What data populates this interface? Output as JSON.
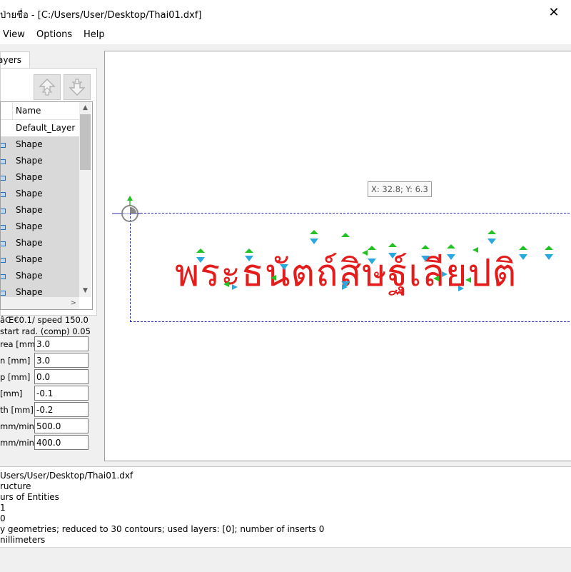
{
  "window": {
    "title": "ป่ายชื่อ - [C:/Users/User/Desktop/Thai01.dxf]",
    "close_glyph": "✕"
  },
  "menu": [
    "View",
    "Options",
    "Help"
  ],
  "layers_panel": {
    "tab_label": "ayers",
    "column_header": "Name",
    "rows": [
      "Default_Layer",
      "Shape",
      "Shape",
      "Shape",
      "Shape",
      "Shape",
      "Shape",
      "Shape",
      "Shape",
      "Shape",
      "Shape"
    ],
    "move_up_icon": "move-up-arrow-icon",
    "move_down_icon": "move-down-arrow-icon"
  },
  "params": {
    "speed_line": "âŒ€0.1/ speed 150.0",
    "start_rad_line": "start rad. (comp) 0.05",
    "fields": [
      {
        "label": "rea [mm]",
        "value": "3.0"
      },
      {
        "label": "n   [mm]",
        "value": "3.0"
      },
      {
        "label": "p   [mm]",
        "value": "0.0"
      },
      {
        "label": "   [mm]",
        "value": "-0.1"
      },
      {
        "label": "th  [mm]",
        "value": "-0.2"
      },
      {
        "label": "mm/min]",
        "value": "500.0"
      },
      {
        "label": "mm/min]",
        "value": "400.0"
      }
    ]
  },
  "canvas": {
    "coordinates": "X: 32.8; Y: 6.3",
    "shape_text": "พระธนัตถ์สิษฐ์เลียปติ",
    "shape_color": "#e41c1c",
    "selection_color": "#2b2bb0"
  },
  "log": [
    "Users/User/Desktop/Thai01.dxf",
    "ructure",
    "urs of Entities",
    "1",
    "0",
    "y geometries; reduced to 30 contours; used layers: [0]; number of inserts 0",
    "nillimeters"
  ]
}
